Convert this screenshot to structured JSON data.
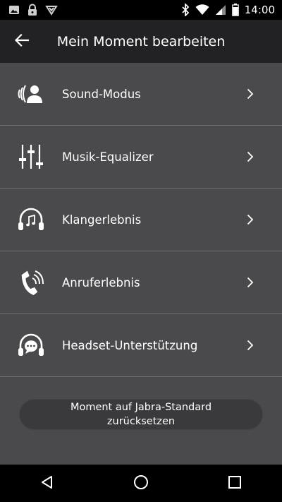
{
  "status_bar": {
    "time": "14:00",
    "left_icons": [
      "image-icon",
      "lock-icon",
      "download-icon"
    ],
    "right_icons": [
      "bluetooth-icon",
      "wifi-icon",
      "signal-icon",
      "battery-icon"
    ]
  },
  "app_bar": {
    "title": "Mein Moment bearbeiten",
    "back_icon": "arrow-back-icon"
  },
  "menu": {
    "items": [
      {
        "label": "Sound-Modus",
        "icon": "sound-mode-icon"
      },
      {
        "label": "Musik-Equalizer",
        "icon": "equalizer-icon"
      },
      {
        "label": "Klangerlebnis",
        "icon": "headphones-music-icon"
      },
      {
        "label": "Anruferlebnis",
        "icon": "phone-call-icon"
      },
      {
        "label": "Headset-Unterstützung",
        "icon": "headset-chat-icon"
      }
    ]
  },
  "reset_button": {
    "label": "Moment auf Jabra-Standard zurücksetzen"
  },
  "nav_bar": {
    "icons": [
      "nav-back-icon",
      "nav-home-icon",
      "nav-recents-icon"
    ]
  },
  "colors": {
    "background": "#4a4a4c",
    "app_bar": "#222224",
    "status_bar": "#000000",
    "divider": "#6f6f72",
    "button": "#3a3a3c"
  }
}
